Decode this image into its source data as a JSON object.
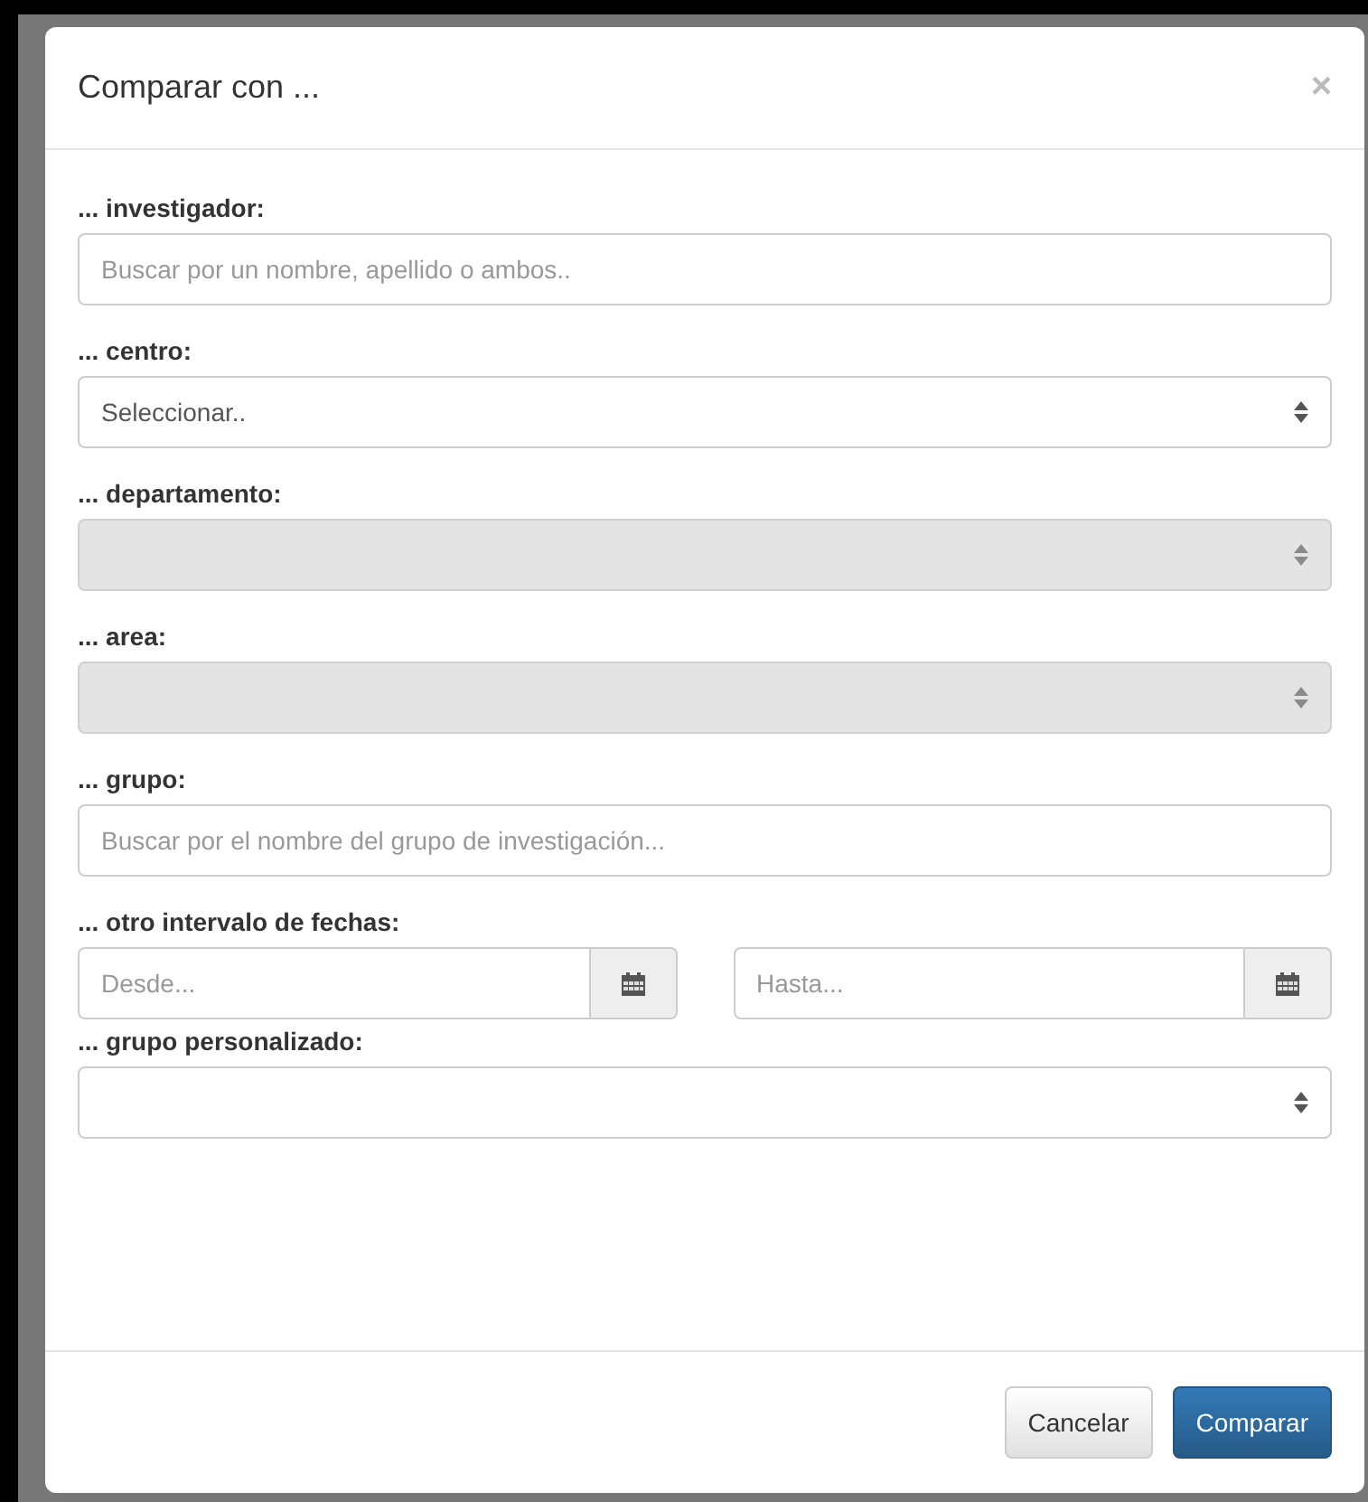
{
  "dialog": {
    "title": "Comparar con ...",
    "close": "×"
  },
  "fields": [
    {
      "kind": "text",
      "label": "... investigador:",
      "placeholder": "Buscar por un nombre, apellido o ambos.."
    },
    {
      "kind": "select",
      "label": "... centro:",
      "value": "Seleccionar..",
      "disabled": false
    },
    {
      "kind": "select",
      "label": "... departamento:",
      "disabled": true
    },
    {
      "kind": "select",
      "label": "... area:",
      "disabled": true
    },
    {
      "kind": "text",
      "label": "... grupo:",
      "placeholder": "Buscar por el nombre del grupo de investigación..."
    },
    {
      "kind": "daterange",
      "label": "... otro intervalo de fechas:",
      "inputs": [
        {
          "placeholder": "Desde..."
        },
        {
          "placeholder": "Hasta..."
        }
      ]
    },
    {
      "kind": "select",
      "label": "... grupo personalizado:",
      "disabled": false
    }
  ],
  "buttons": [
    {
      "label": "Cancelar",
      "kind": "default"
    },
    {
      "label": "Comparar",
      "kind": "primary"
    }
  ]
}
